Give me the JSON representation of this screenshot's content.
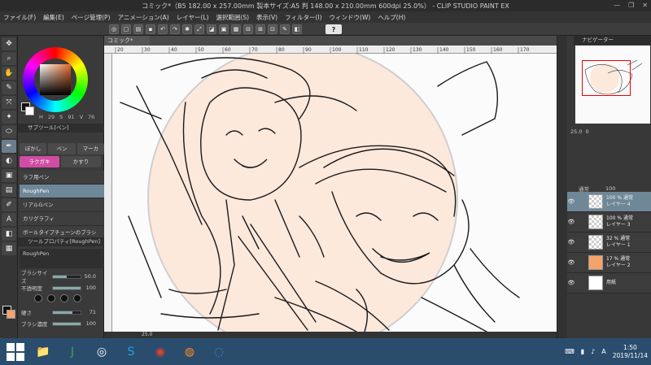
{
  "window": {
    "title": "コミック*（B5 182.00 x 257.00mm 製本サイズ:A5 判 148.00 x 210.00mm 600dpi 25.0%） - CLIP STUDIO PAINT EX",
    "controls": [
      "—",
      "❐",
      "✕"
    ]
  },
  "menu": [
    "ファイル(F)",
    "編集(E)",
    "ページ管理(P)",
    "アニメーション(A)",
    "レイヤー(L)",
    "選択範囲(S)",
    "表示(V)",
    "フィルター(I)",
    "ウィンドウ(W)",
    "ヘルプ(H)"
  ],
  "command_bar": {
    "help_label": "?"
  },
  "tools": [
    "✥",
    "⌕",
    "✋",
    "✎",
    "⤧",
    "✦",
    "⬭",
    "✒",
    "◐",
    "▣",
    "▤",
    "✐",
    "A",
    "◧",
    "▦"
  ],
  "color_panel": {
    "values": [
      "H",
      "29",
      "S",
      "91",
      "V",
      "76"
    ]
  },
  "subtool": {
    "title": "サブツール[ペン]",
    "tabs": [
      "ぼかし",
      "ペン",
      "マーカ"
    ],
    "tabs2": [
      "ラクガキ",
      "かすり"
    ],
    "brushes": [
      "ラフ用ペン",
      "RoughPen",
      "リアルGペン",
      "カリグラフィ",
      "ボールタイプチューンのブラシ"
    ],
    "selected_brush": "RoughPen"
  },
  "tool_property": {
    "title": "ツールプロパティ[RoughPen]",
    "brush_name": "RoughPen",
    "props": [
      {
        "label": "ブラシサイズ",
        "value": "50.0",
        "pct": 0.5
      },
      {
        "label": "不透明度",
        "value": "100",
        "pct": 1.0
      },
      {
        "label": "硬さ",
        "value": "71",
        "pct": 0.71
      },
      {
        "label": "ブラシ濃度",
        "value": "100",
        "pct": 1.0
      }
    ]
  },
  "canvas": {
    "tab_label": "コミック*",
    "ruler_marks": [
      "20",
      "30",
      "40",
      "50",
      "60",
      "70",
      "80",
      "90",
      "100",
      "110",
      "120",
      "130",
      "140",
      "150",
      "160",
      "170"
    ],
    "zoom": "25.0"
  },
  "navigator": {
    "title": "ナビゲーター",
    "zoom": "25.0",
    "angle": "0"
  },
  "layers": {
    "blend_mode": "通常",
    "opacity": "100",
    "items": [
      {
        "name": "レイヤー 4",
        "mode": "100 % 通常",
        "selected": true,
        "thumb": "checker"
      },
      {
        "name": "レイヤー 3",
        "mode": "100 % 通常",
        "selected": false,
        "thumb": "checker"
      },
      {
        "name": "レイヤー 1",
        "mode": "32 % 通常",
        "selected": false,
        "thumb": "checker"
      },
      {
        "name": "レイヤー 2",
        "mode": "17 % 通常",
        "selected": false,
        "thumb": "orange"
      },
      {
        "name": "用紙",
        "mode": "",
        "selected": false,
        "thumb": "solid"
      }
    ]
  },
  "taskbar": {
    "apps": [
      {
        "name": "file-explorer",
        "glyph": "📁",
        "color": "#e6b84a"
      },
      {
        "name": "j-app",
        "glyph": "J",
        "color": "#3aa84a"
      },
      {
        "name": "clip-studio",
        "glyph": "◎",
        "color": "#ffffff"
      },
      {
        "name": "skype",
        "glyph": "S",
        "color": "#1fa0e0"
      },
      {
        "name": "chrome",
        "glyph": "◉",
        "color": "#e04030"
      },
      {
        "name": "firefox",
        "glyph": "◍",
        "color": "#ff8a1e"
      },
      {
        "name": "globe",
        "glyph": "◌",
        "color": "#3a8ad8"
      }
    ],
    "tray_lang": "A",
    "time": "1:50",
    "date": "2019/11/14"
  }
}
